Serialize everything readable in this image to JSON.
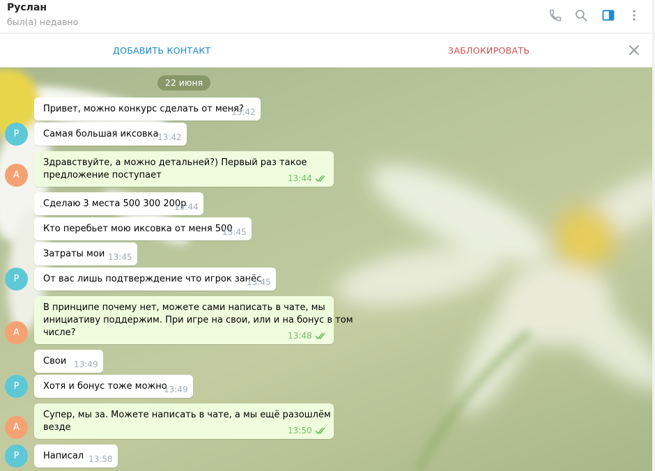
{
  "header": {
    "name": "Руслан",
    "status": "был(а) недавно"
  },
  "actions": {
    "add_contact": "ДОБАВИТЬ КОНТАКТ",
    "block": "ЗАБЛОКИРОВАТЬ"
  },
  "date_label": "22 июня",
  "avatars": {
    "peer": "Р",
    "self": "А"
  },
  "messages": [
    {
      "direction": "in",
      "text": "Привет, можно конкурс сделать от меня?",
      "time": "13:42"
    },
    {
      "direction": "in",
      "text": "Самая большая иксовка",
      "time": "13:42"
    },
    {
      "direction": "out",
      "text": "Здравствуйте, а можно детальней?) Первый раз такое\nпредложение поступает",
      "time": "13:44",
      "read": true
    },
    {
      "direction": "in",
      "text": "Сделаю 3 места 500 300 200р",
      "time": "13:44"
    },
    {
      "direction": "in",
      "text": "Кто перебьет мою иксовка от меня 500",
      "time": "13:45"
    },
    {
      "direction": "in",
      "text": "Затраты мои",
      "time": "13:45"
    },
    {
      "direction": "in",
      "text": "От вас лишь подтверждение что игрок занёс",
      "time": "13:45"
    },
    {
      "direction": "out",
      "text": "В принципе почему нет, можете сами написать в чате, мы\nинициативу поддержим. При игре на свои, или и на бонус в том\nчисле?",
      "time": "13:48",
      "read": true
    },
    {
      "direction": "in",
      "text": "Свои",
      "time": "13:49"
    },
    {
      "direction": "in",
      "text": "Хотя и бонус тоже можно",
      "time": "13:49"
    },
    {
      "direction": "out",
      "text": "Супер, мы за. Можете написать в чате, а мы ещё разошлём\nвезде",
      "time": "13:50",
      "read": true
    },
    {
      "direction": "in",
      "text": "Написал",
      "time": "13:58"
    }
  ],
  "colors": {
    "accent": "#168acd",
    "danger": "#d14e4e",
    "outgoing_bubble": "#effdde",
    "read_check": "#6cc264"
  }
}
